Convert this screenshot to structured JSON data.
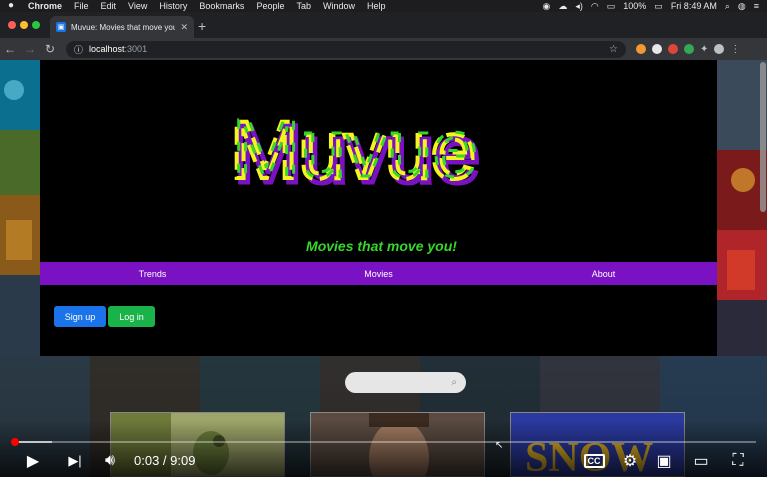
{
  "menubar": {
    "apple": "",
    "items": [
      "Chrome",
      "File",
      "Edit",
      "View",
      "History",
      "Bookmarks",
      "People",
      "Tab",
      "Window",
      "Help"
    ],
    "battery": "100%",
    "clock": "Fri 8:49 AM"
  },
  "browser": {
    "tab_title": "Muvue: Movies that move you!",
    "url_host": "localhost",
    "url_port": ":3001",
    "traffic_colors": [
      "#ff5f57",
      "#febc2e",
      "#28c840"
    ],
    "extension_colors": [
      "#f09a36",
      "#e8e8e8",
      "#e0453a",
      "#34a853",
      "#bdc1c6",
      "#8f6bd9"
    ]
  },
  "site": {
    "logo_text": "Muvue",
    "logo_colors": [
      "#37d62a",
      "#f5f51e",
      "#7a12c4"
    ],
    "tagline": "Movies that move you!",
    "nav": [
      "Trends",
      "Movies",
      "About"
    ],
    "signup_label": "Sign up",
    "login_label": "Log in",
    "signup_color": "#1a73e8",
    "login_color": "#19b34a",
    "nav_color": "#7a12c4",
    "card3_text": "SNOW"
  },
  "player": {
    "current_time": "0:03",
    "duration": "9:09",
    "time_display": "0:03 / 9:09",
    "progress_fraction": 0.0055,
    "buffered_fraction": 0.055,
    "cc_label": "CC"
  }
}
